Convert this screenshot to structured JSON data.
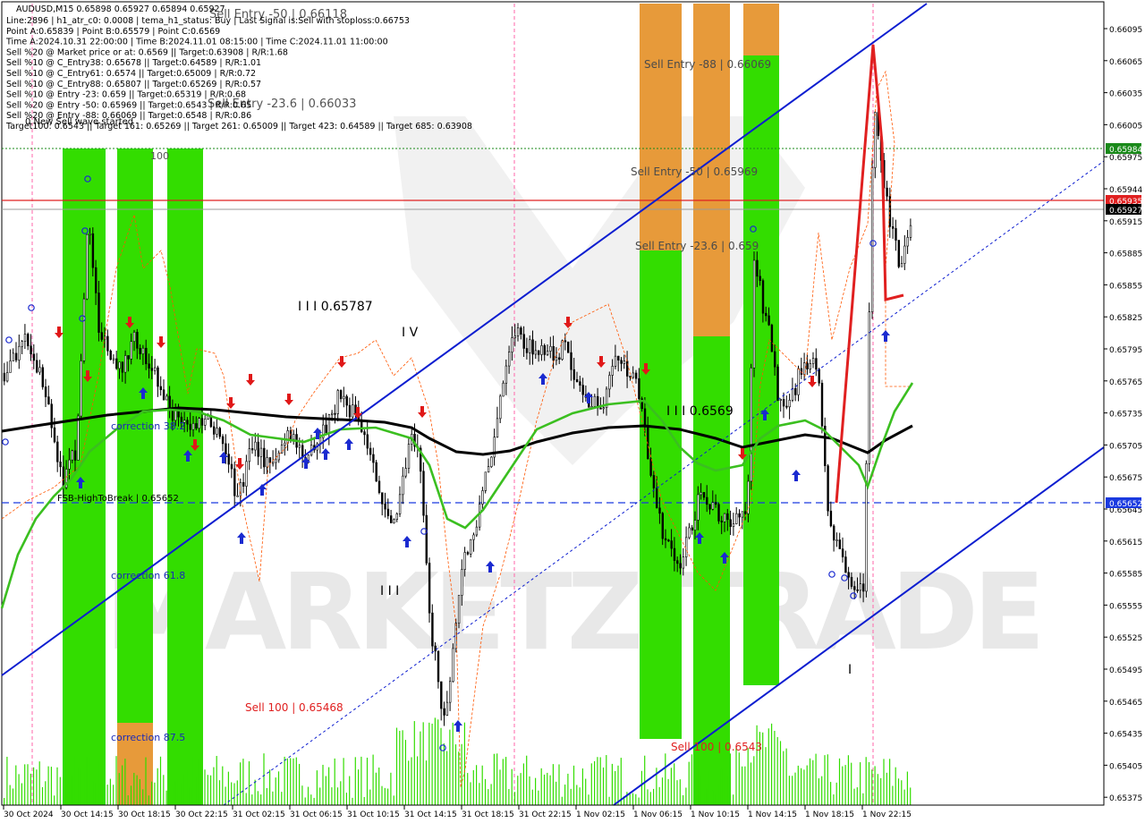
{
  "symbol_line": "AUDUSD,M15  0.65898 0.65927 0.65894 0.65927",
  "info_lines": [
    "Line:2896 | h1_atr_c0: 0.0008 | tema_h1_status: Buy | Last Signal is:Sell with stoploss:0.66753",
    "Point A:0.65839 | Point B:0.65579 | Point C:0.6569",
    "Time A:2024.10.31 22:00:00 | Time B:2024.11.01 08:15:00 | Time C:2024.11.01 11:00:00",
    "Sell %20 @ Market price or at: 0.6569 || Target:0.63908 | R/R:1.68",
    "Sell %10 @ C_Entry38: 0.65678 || Target:0.64589 | R/R:1.01",
    "Sell %10 @ C_Entry61: 0.6574 || Target:0.65009 | R/R:0.72",
    "Sell %10 @ C_Entry88: 0.65807 || Target:0.65269 | R/R:0.57",
    "Sell %10 @ Entry -23: 0.659 || Target:0.65319 | R/R:0.68",
    "Sell %20 @ Entry -50: 0.65969 || Target:0.6543 | R/R:0.65",
    "Sell %20 @ Entry -88: 0.66069 || Target:0.6548 | R/R:0.86",
    "Target100: 0.6543 || Target 161: 0.65269 || Target 261: 0.65009 || Target 423: 0.64589 || Target 685: 0.63908"
  ],
  "wave_status": "0 New Sell wave started",
  "labels": {
    "sell_entry_50_left": "Sell Entry -50 | 0.66118",
    "sell_entry_23_left": "Sell Entry -23.6 | 0.66033",
    "sell_entry_88_right": "Sell Entry -88 | 0.66069",
    "sell_entry_50_right": "Sell Entry -50 | 0.65969",
    "sell_entry_23_right": "Sell Entry -23.6 | 0.659",
    "wave_iii_left": "I I I 0.65787",
    "wave_iv": "I V",
    "wave_iii_mid": "I I I 0.6569",
    "wave_iii_small": "I I I",
    "wave_i_small": "I",
    "level_100": "100",
    "correction_38": "correction 38.2",
    "correction_61": "correction 61.8",
    "correction_87": "correction 87.5",
    "fsb": "FSB-HighToBreak | 0.65652",
    "sell_100_left": "Sell 100 | 0.65468",
    "sell_100_right": "Sell 100 | 0.6543",
    "watermark": "MARKETZITRADE"
  },
  "price_axis": [
    "0.66095",
    "0.66065",
    "0.66035",
    "0.66005",
    "0.65975",
    "0.65944",
    "0.65915",
    "0.65885",
    "0.65855",
    "0.65825",
    "0.65795",
    "0.65765",
    "0.65735",
    "0.65705",
    "0.65675",
    "0.65645",
    "0.65615",
    "0.65585",
    "0.65555",
    "0.65525",
    "0.65495",
    "0.65465",
    "0.65435",
    "0.65405",
    "0.65375"
  ],
  "price_tags": [
    {
      "value": "0.65984",
      "color": "#1a8a1a",
      "text_color": "#ffffff"
    },
    {
      "value": "0.65935",
      "color": "#e02020",
      "text_color": "#ffffff"
    },
    {
      "value": "0.65927",
      "color": "#000000",
      "text_color": "#ffffff"
    },
    {
      "value": "0.65652",
      "color": "#1a3ae0",
      "text_color": "#ffffff"
    }
  ],
  "time_axis": [
    "30 Oct 2024",
    "30 Oct 14:15",
    "30 Oct 18:15",
    "30 Oct 22:15",
    "31 Oct 02:15",
    "31 Oct 06:15",
    "31 Oct 10:15",
    "31 Oct 14:15",
    "31 Oct 18:15",
    "31 Oct 22:15",
    "1 Nov 02:15",
    "1 Nov 06:15",
    "1 Nov 10:15",
    "1 Nov 14:15",
    "1 Nov 18:15",
    "1 Nov 22:15"
  ],
  "colors": {
    "green_zone": "#33dd00",
    "orange_zone": "#e79a3a",
    "trend_blue": "#0d1ed0",
    "ma_black": "#000000",
    "ma_green": "#3bbf20",
    "sell_red": "#e02020",
    "fsb_blue": "#1a3ae0",
    "volume_green": "#33dd00",
    "stop_orange": "#ff5500",
    "watermark": "#d9d9d9"
  }
}
